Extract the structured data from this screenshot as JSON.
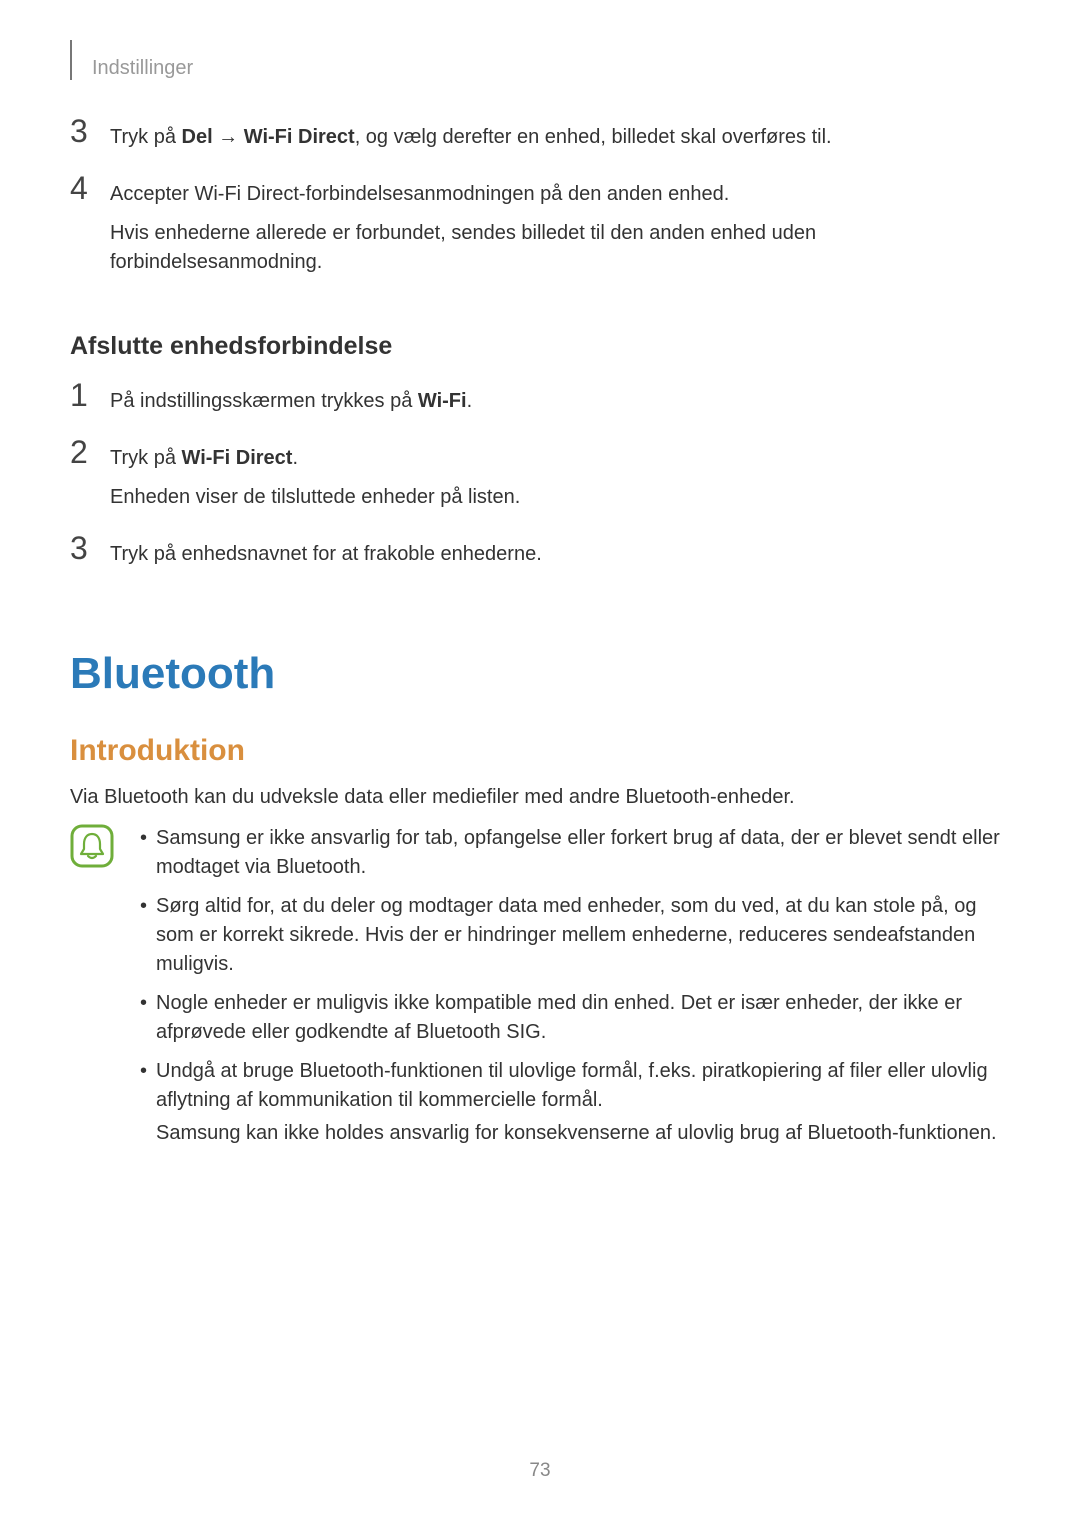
{
  "header": {
    "section": "Indstillinger"
  },
  "steps_a": [
    {
      "num": "3",
      "parts": [
        {
          "t": "Tryk på "
        },
        {
          "t": "Del",
          "b": true
        },
        {
          "t": " → "
        },
        {
          "t": "Wi-Fi Direct",
          "b": true
        },
        {
          "t": ", og vælg derefter en enhed, billedet skal overføres til."
        }
      ]
    },
    {
      "num": "4",
      "parts": [
        {
          "t": "Accepter Wi-Fi Direct-forbindelsesanmodningen på den anden enhed."
        }
      ],
      "extra": "Hvis enhederne allerede er forbundet, sendes billedet til den anden enhed uden forbindelsesanmodning."
    }
  ],
  "subheading": "Afslutte enhedsforbindelse",
  "steps_b": [
    {
      "num": "1",
      "parts": [
        {
          "t": "På indstillingsskærmen trykkes på "
        },
        {
          "t": "Wi-Fi",
          "b": true
        },
        {
          "t": "."
        }
      ]
    },
    {
      "num": "2",
      "parts": [
        {
          "t": "Tryk på "
        },
        {
          "t": "Wi-Fi Direct",
          "b": true
        },
        {
          "t": "."
        }
      ],
      "extra": "Enheden viser de tilsluttede enheder på listen."
    },
    {
      "num": "3",
      "parts": [
        {
          "t": "Tryk på enhedsnavnet for at frakoble enhederne."
        }
      ]
    }
  ],
  "h1": "Bluetooth",
  "h2": "Introduktion",
  "intro_text": "Via Bluetooth kan du udveksle data eller mediefiler med andre Bluetooth-enheder.",
  "note_icon_name": "bell-note-icon",
  "bullets": [
    {
      "text": "Samsung er ikke ansvarlig for tab, opfangelse eller forkert brug af data, der er blevet sendt eller modtaget via Bluetooth."
    },
    {
      "text": "Sørg altid for, at du deler og modtager data med enheder, som du ved, at du kan stole på, og som er korrekt sikrede. Hvis der er hindringer mellem enhederne, reduceres sendeafstanden muligvis."
    },
    {
      "text": "Nogle enheder er muligvis ikke kompatible med din enhed. Det er især enheder, der ikke er afprøvede eller godkendte af Bluetooth SIG."
    },
    {
      "text": "Undgå at bruge Bluetooth-funktionen til ulovlige formål, f.eks. piratkopiering af filer eller ulovlig aflytning af kommunikation til kommercielle formål.",
      "extra": "Samsung kan ikke holdes ansvarlig for konsekvenserne af ulovlig brug af Bluetooth-funktionen."
    }
  ],
  "page_number": "73"
}
